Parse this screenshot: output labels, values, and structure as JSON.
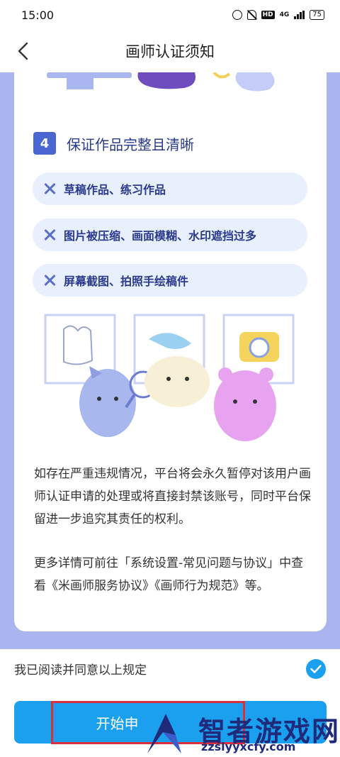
{
  "status_bar": {
    "time": "15:00",
    "hd": "HD",
    "network": "4G",
    "battery": "75"
  },
  "header": {
    "title": "画师认证须知"
  },
  "section": {
    "number": "4",
    "title": "保证作品完整且清晰",
    "items": [
      {
        "label": "草稿作品、练习作品"
      },
      {
        "label": "图片被压缩、画面模糊、水印遮挡过多"
      },
      {
        "label": "屏幕截图、拍照手绘稿件"
      }
    ]
  },
  "paragraphs": [
    "如存在严重违规情况，平台将会永久暂停对该用户画师认证申请的处理或将直接封禁该账号，同时平台保留进一步追究其责任的权利。",
    "更多详情可前往「系统设置-常见问题与协议」中查看《米画师服务协议》《画师行为规范》等。"
  ],
  "agreement": {
    "label": "我已阅读并同意以上规定",
    "checked": true
  },
  "footer": {
    "button_label": "开始申请画师认证",
    "button_label_visible": "开始申"
  },
  "watermark": {
    "name": "智者游戏网",
    "url": "zzslyyxcfy.com"
  },
  "colors": {
    "accent": "#1aa0ee",
    "badge": "#4a66d1",
    "pill_bg": "#e8f0fd",
    "page_bg": "#aab4ee",
    "highlight": "#d93040"
  }
}
